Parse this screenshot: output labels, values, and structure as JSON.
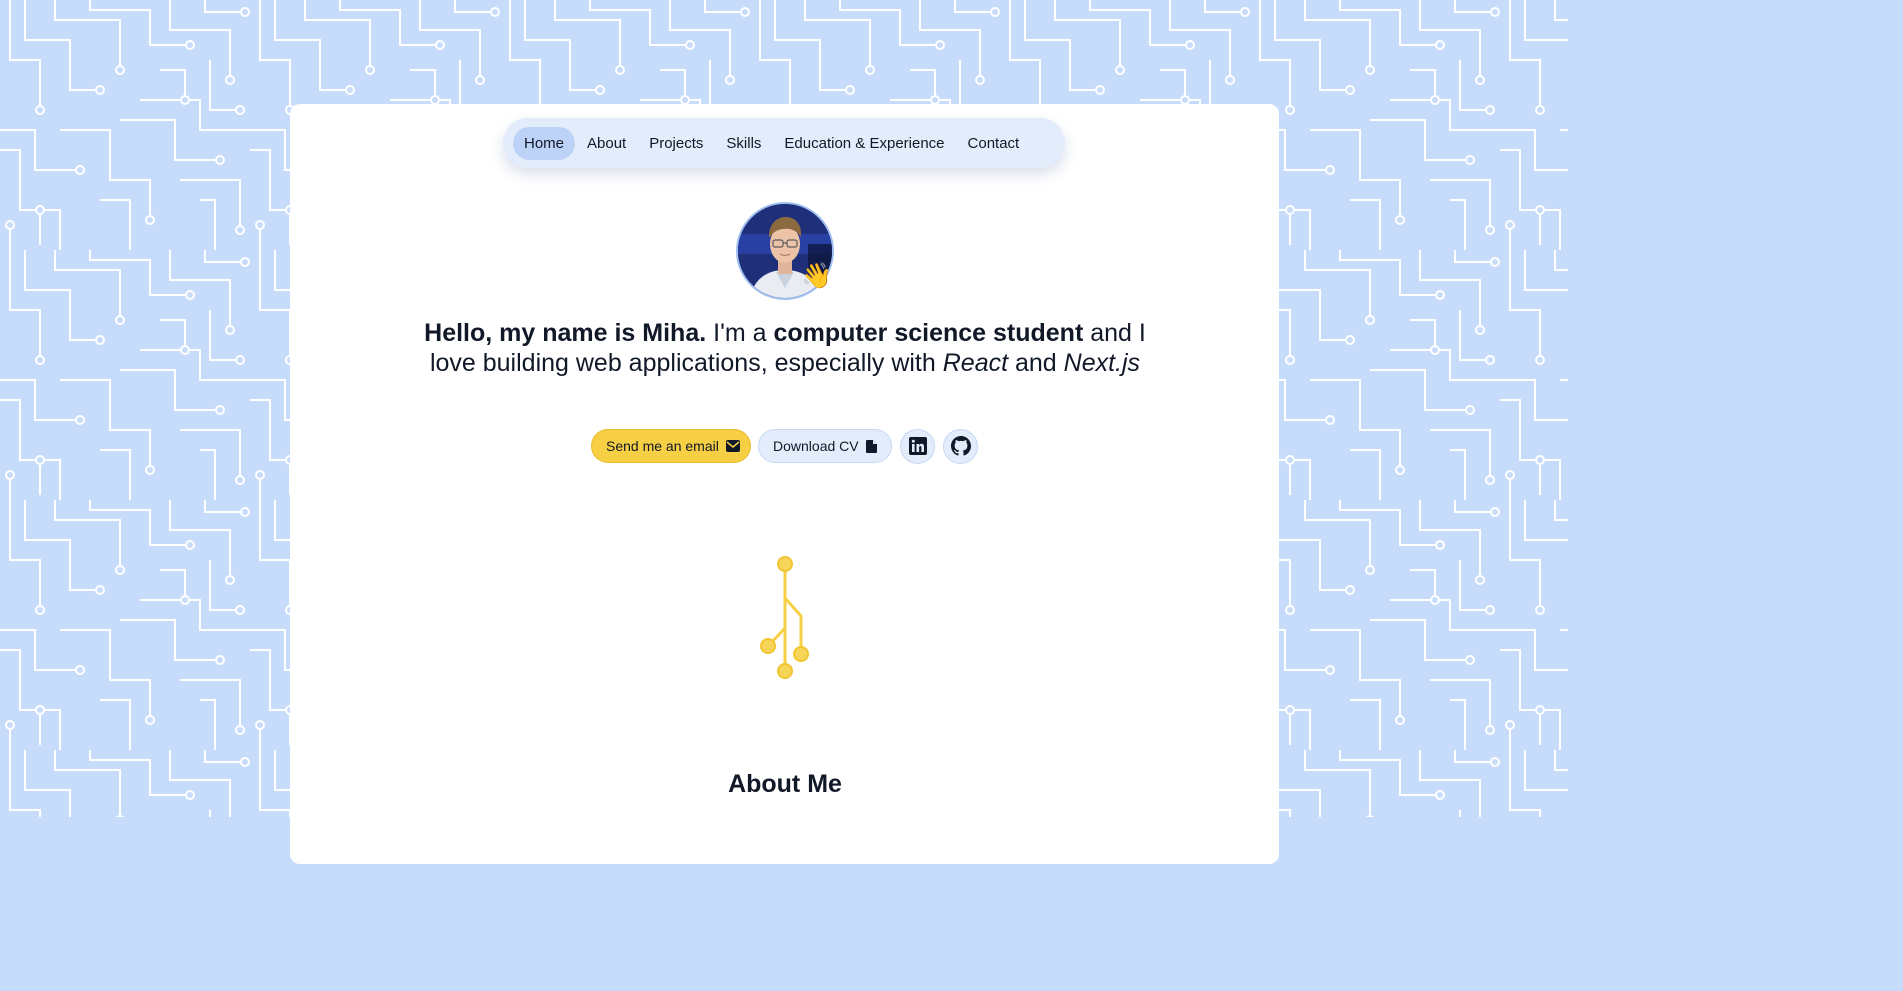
{
  "nav": {
    "items": [
      {
        "label": "Home",
        "active": true
      },
      {
        "label": "About",
        "active": false
      },
      {
        "label": "Projects",
        "active": false
      },
      {
        "label": "Skills",
        "active": false
      },
      {
        "label": "Education & Experience",
        "active": false
      },
      {
        "label": "Contact",
        "active": false
      }
    ]
  },
  "hero": {
    "wave_emoji": "👋",
    "intro_bold": "Hello, my name is Miha.",
    "intro_pre": " I'm a ",
    "role_bold": "computer science student",
    "intro_mid": " and I love building web applications, especially with ",
    "tech_1": "React",
    "intro_and": " and ",
    "tech_2": "Next.js"
  },
  "actions": {
    "email_label": "Send me an email",
    "email_icon": "envelope-icon",
    "cv_label": "Download CV",
    "cv_icon": "file-icon",
    "linkedin_icon": "linkedin-icon",
    "github_icon": "github-icon"
  },
  "sections": {
    "about_title": "About Me"
  },
  "colors": {
    "background": "#c7dcfb",
    "circuit_lines": "#ffffff",
    "card": "#ffffff",
    "nav_bg": "#e3ecfb",
    "nav_active": "#bcd3f7",
    "accent_yellow": "#f7cf44",
    "text": "#111827"
  }
}
